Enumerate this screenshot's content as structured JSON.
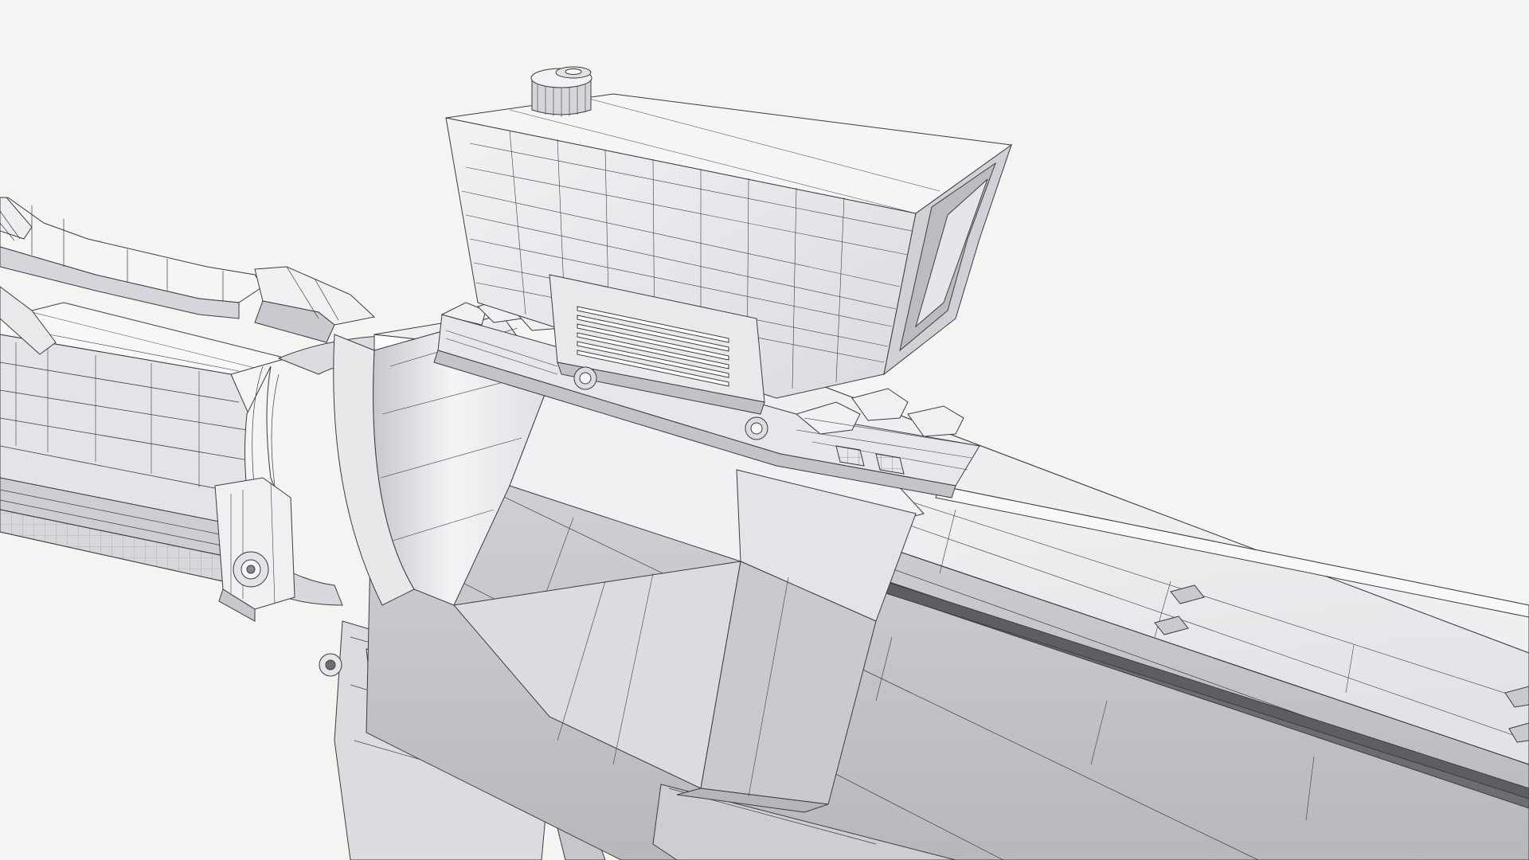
{
  "scene": {
    "background_color": "#f4f4f2",
    "surface_color": "#ededee",
    "shadow_color": "#b8b6be",
    "wire_color": "#3c3c40",
    "groove_color": "#6e6c72"
  }
}
